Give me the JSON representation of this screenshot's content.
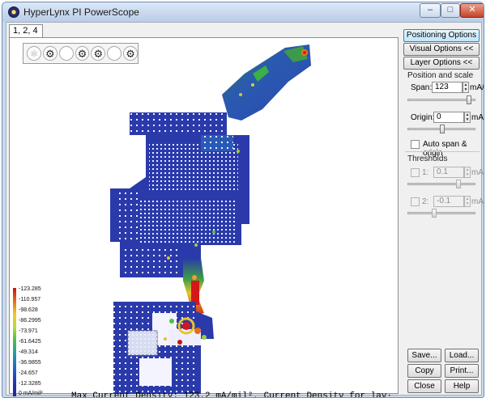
{
  "window": {
    "title": "HyperLynx PI PowerScope",
    "minimize_glyph": "–",
    "maximize_glyph": "□",
    "close_glyph": "✕"
  },
  "tab": {
    "label": "1, 2, 4"
  },
  "toolbar": {
    "icons": [
      "disabled-view-icon",
      "rotate-view-icon",
      "blank-icon",
      "rotate-view-icon",
      "rotate-view-icon",
      "blank-icon",
      "rotate-view-icon"
    ]
  },
  "legend": {
    "unit": "0 mA/mil²",
    "ticks": [
      "-123.285",
      "-110.957",
      "-98.628",
      "-86.2995",
      "-73.971",
      "-61.6425",
      "-49.314",
      "-36.9855",
      "-24.657",
      "-12.3285"
    ]
  },
  "status_text": "Max Current Density: 123.2 mA/mil², Current Density for lay·",
  "panel": {
    "positioning_button": "Positioning Options >>",
    "visual_button": "Visual Options <<",
    "layer_button": "Layer Options <<",
    "position_scale_title": "Position and scale",
    "span_label": "Span:",
    "span_value": "123",
    "span_unit": "mA/mi",
    "origin_label": "Origin:",
    "origin_value": "0",
    "origin_unit": "mA/mi",
    "auto_label": "Auto span & origin",
    "thresholds_title": "Thresholds",
    "t1_label": "1:",
    "t1_value": "0.1",
    "t1_unit": "mA/mi",
    "t2_label": "2:",
    "t2_value": "-0.1",
    "t2_unit": "mA/mi",
    "save_button": "Save...",
    "load_button": "Load...",
    "copy_button": "Copy",
    "print_button": "Print...",
    "close_button": "Close",
    "help_button": "Help"
  }
}
